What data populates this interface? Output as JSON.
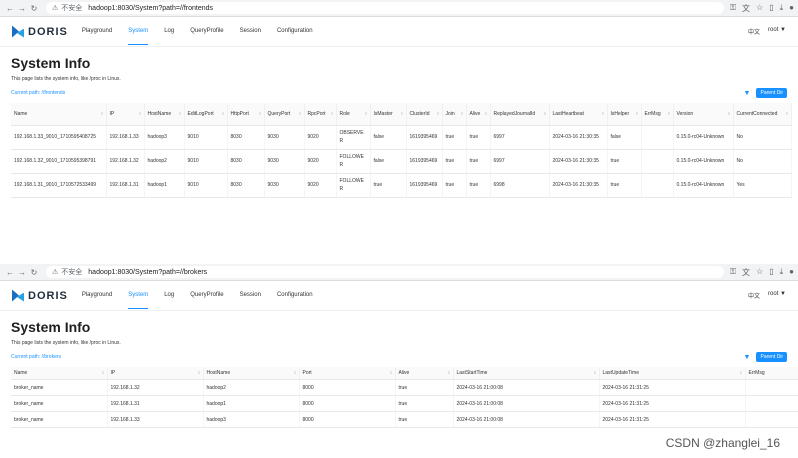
{
  "shots": [
    {
      "browser": {
        "insecure_label": "不安全",
        "url": "hadoop1:8030/System?path=//frontends"
      },
      "logo_text": "DORIS",
      "nav": [
        "Playground",
        "System",
        "Log",
        "QueryProfile",
        "Session",
        "Configuration"
      ],
      "active_nav": "System",
      "lang": "中文",
      "user": "root ▼",
      "title": "System Info",
      "description": "This page lists the system info, like /proc in Linux.",
      "current_path": "Current path: //frontends",
      "parent_button": "Parent Dir",
      "columns": [
        "Name",
        "IP",
        "HostName",
        "EditLogPort",
        "HttpPort",
        "QueryPort",
        "RpcPort",
        "Role",
        "IsMaster",
        "ClusterId",
        "Join",
        "Alive",
        "ReplayedJournalId",
        "LastHeartbeat",
        "IsHelper",
        "ErrMsg",
        "Version",
        "CurrentConnected"
      ],
      "rows": [
        [
          "192.168.1.33_9010_1710595408725",
          "192.168.1.33",
          "hadoop3",
          "9010",
          "8030",
          "9030",
          "9020",
          "OBSERVER",
          "false",
          "1619395469",
          "true",
          "true",
          "6997",
          "2024-03-16 21:30:35",
          "false",
          "",
          "0.15.0-rc04-Unknown",
          "No"
        ],
        [
          "192.168.1.32_9010_1710595398791",
          "192.168.1.32",
          "hadoop2",
          "9010",
          "8030",
          "9030",
          "9020",
          "FOLLOWER",
          "false",
          "1619395469",
          "true",
          "true",
          "6997",
          "2024-03-16 21:30:35",
          "true",
          "",
          "0.15.0-rc04-Unknown",
          "No"
        ],
        [
          "192.168.1.31_9010_1710572533499",
          "192.168.1.31",
          "hadoop1",
          "9010",
          "8030",
          "9030",
          "9020",
          "FOLLOWER",
          "true",
          "1619395469",
          "true",
          "true",
          "6998",
          "2024-03-16 21:30:35",
          "true",
          "",
          "0.15.0-rc04-Unknown",
          "Yes"
        ]
      ]
    },
    {
      "browser": {
        "insecure_label": "不安全",
        "url": "hadoop1:8030/System?path=//brokers"
      },
      "logo_text": "DORIS",
      "nav": [
        "Playground",
        "System",
        "Log",
        "QueryProfile",
        "Session",
        "Configuration"
      ],
      "active_nav": "System",
      "lang": "中文",
      "user": "root ▼",
      "title": "System Info",
      "description": "This page lists the system info, like /proc in Linux.",
      "current_path": "Current path: //brokers",
      "parent_button": "Parent Dir",
      "columns": [
        "Name",
        "IP",
        "HostName",
        "Port",
        "Alive",
        "LastStartTime",
        "LastUpdateTime",
        "ErrMsg"
      ],
      "rows": [
        [
          "broker_name",
          "192.168.1.32",
          "hadoop2",
          "8000",
          "true",
          "2024-03-16 21:00:08",
          "2024-03-16 21:31:25",
          ""
        ],
        [
          "broker_name",
          "192.168.1.31",
          "hadoop1",
          "8000",
          "true",
          "2024-03-16 21:00:08",
          "2024-03-16 21:31:25",
          ""
        ],
        [
          "broker_name",
          "192.168.1.33",
          "hadoop3",
          "8000",
          "true",
          "2024-03-16 21:00:08",
          "2024-03-16 21:31:25",
          ""
        ]
      ]
    }
  ],
  "watermark": "CSDN @zhanglei_16",
  "icons": {
    "back": "arrow-left-icon",
    "forward": "arrow-right-icon",
    "reload": "reload-icon",
    "warning": "warning-icon",
    "filter": "filter-icon",
    "sort": "sort-icon"
  },
  "colors": {
    "accent": "#1890ff",
    "logo_dark": "#1a6fc2",
    "logo_light": "#27a0e3"
  }
}
